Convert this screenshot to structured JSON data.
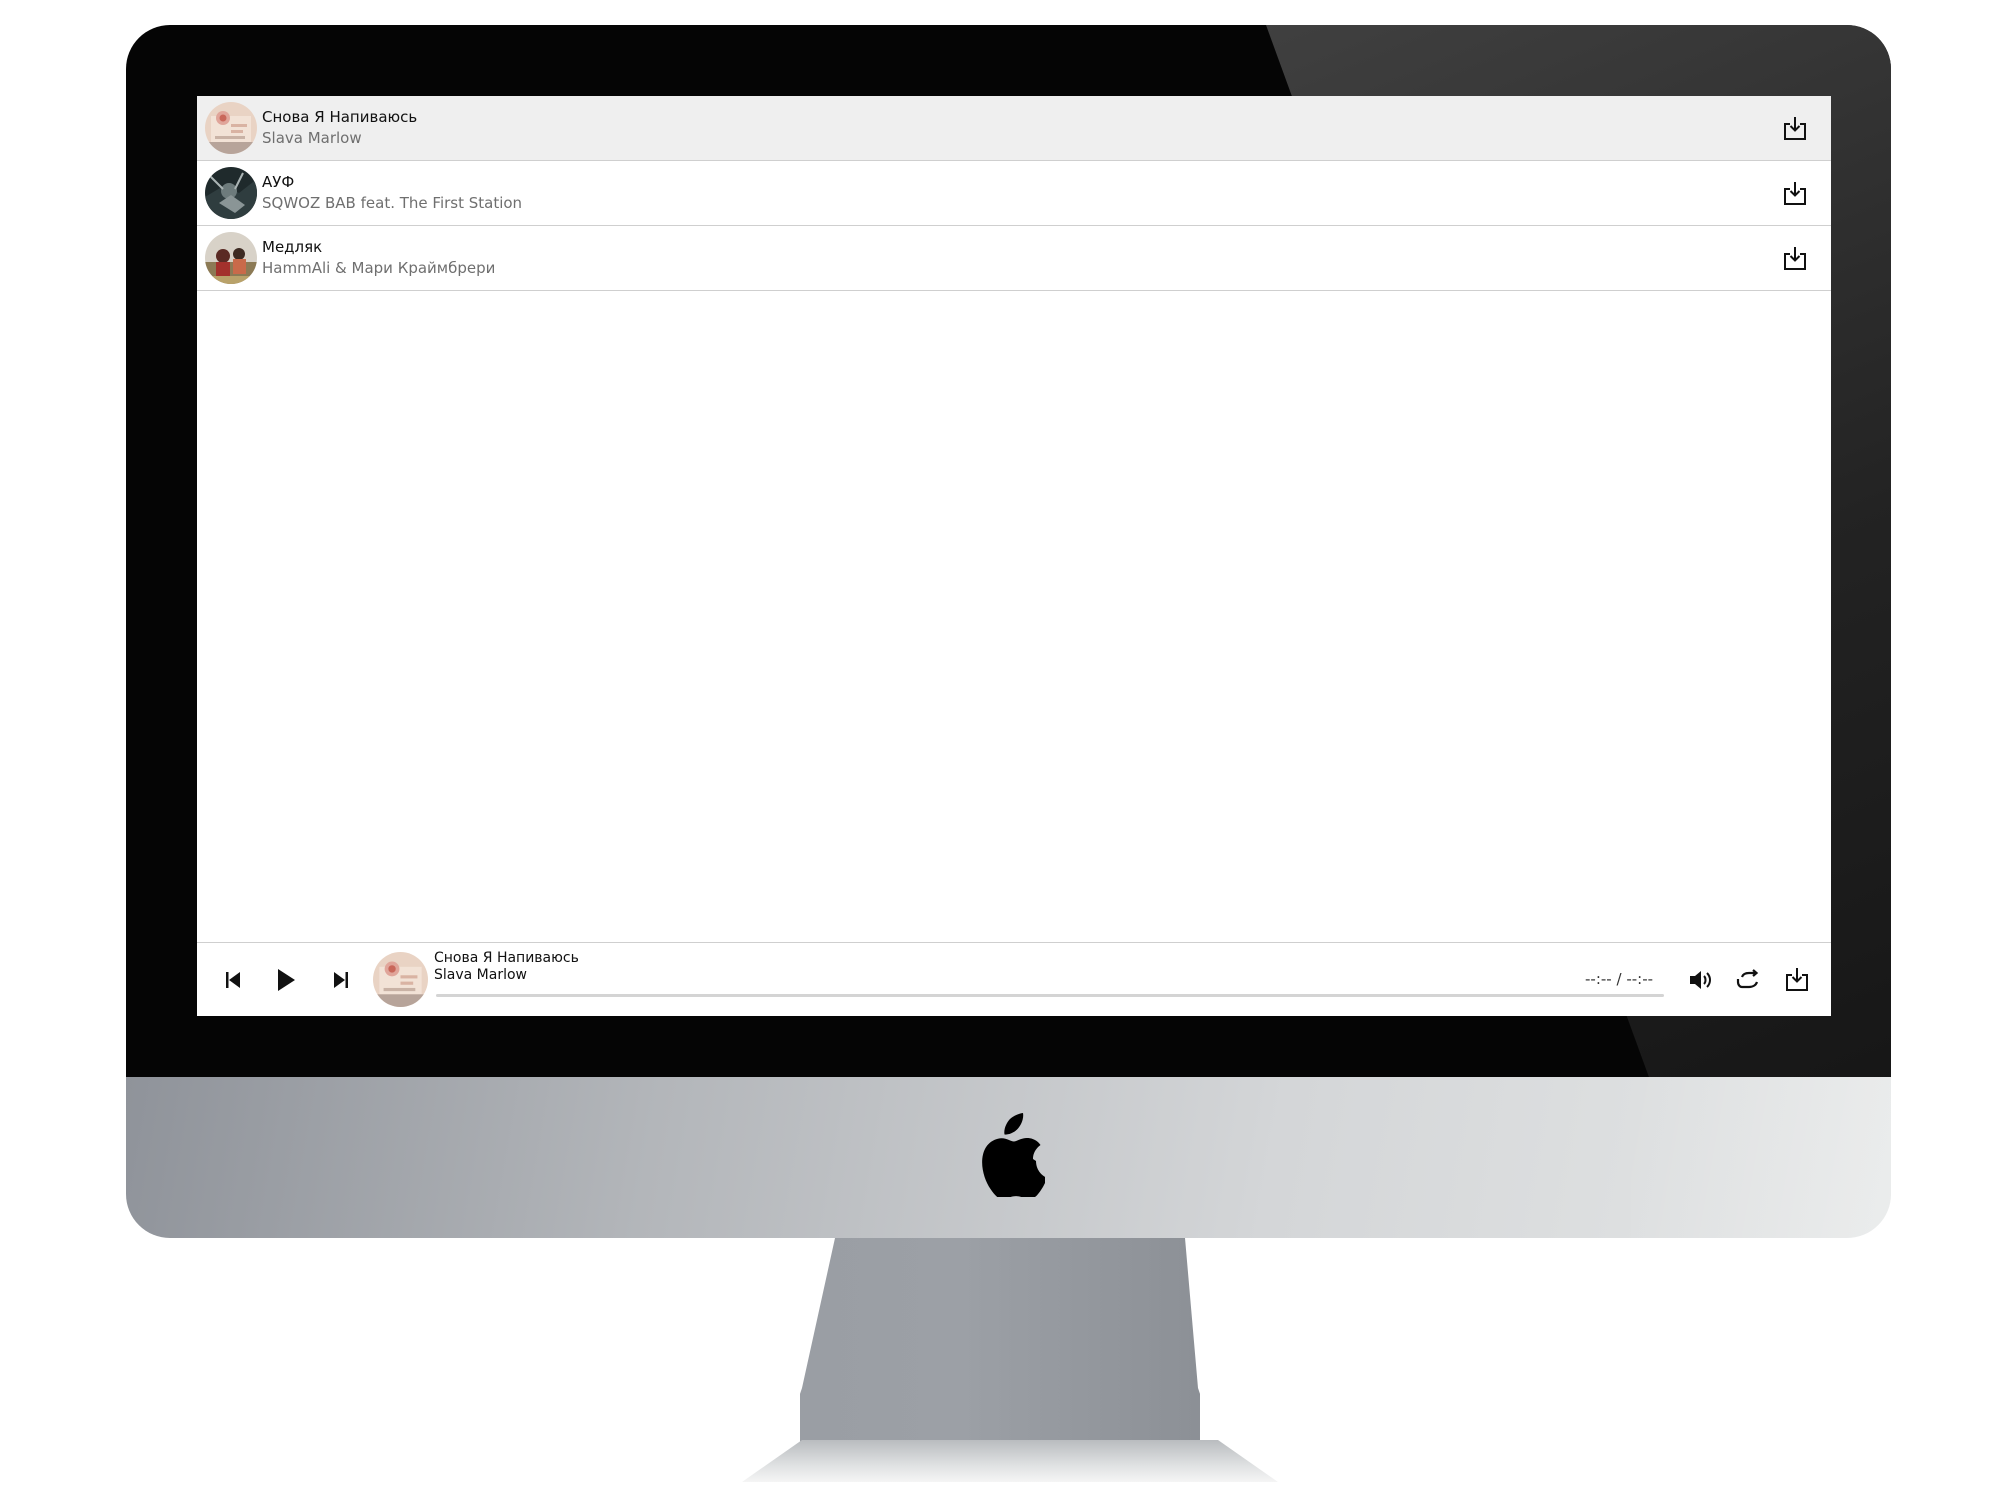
{
  "tracks": [
    {
      "title": "Снова Я Напиваюсь",
      "artist": "Slava Marlow",
      "active": true,
      "cover_icon": "album-cover"
    },
    {
      "title": "АУФ",
      "artist": "SQWOZ BAB feat. The First Station",
      "active": false,
      "cover_icon": "album-cover"
    },
    {
      "title": "Медляк",
      "artist": "HammAli & Мари Краймбрери",
      "active": false,
      "cover_icon": "album-cover"
    }
  ],
  "player": {
    "now_playing_title": "Снова Я Напиваюсь",
    "now_playing_artist": "Slava Marlow",
    "current_time": "--:--",
    "separator": " / ",
    "total_time": "--:--",
    "progress": 0,
    "controls": [
      "previous-icon",
      "play-icon",
      "next-icon",
      "volume-icon",
      "repeat-icon",
      "download-icon"
    ]
  },
  "colors": {
    "active_row": "#efefef",
    "divider": "#cfcfcf",
    "title_text": "#111111",
    "artist_text": "#6f6f6f"
  }
}
